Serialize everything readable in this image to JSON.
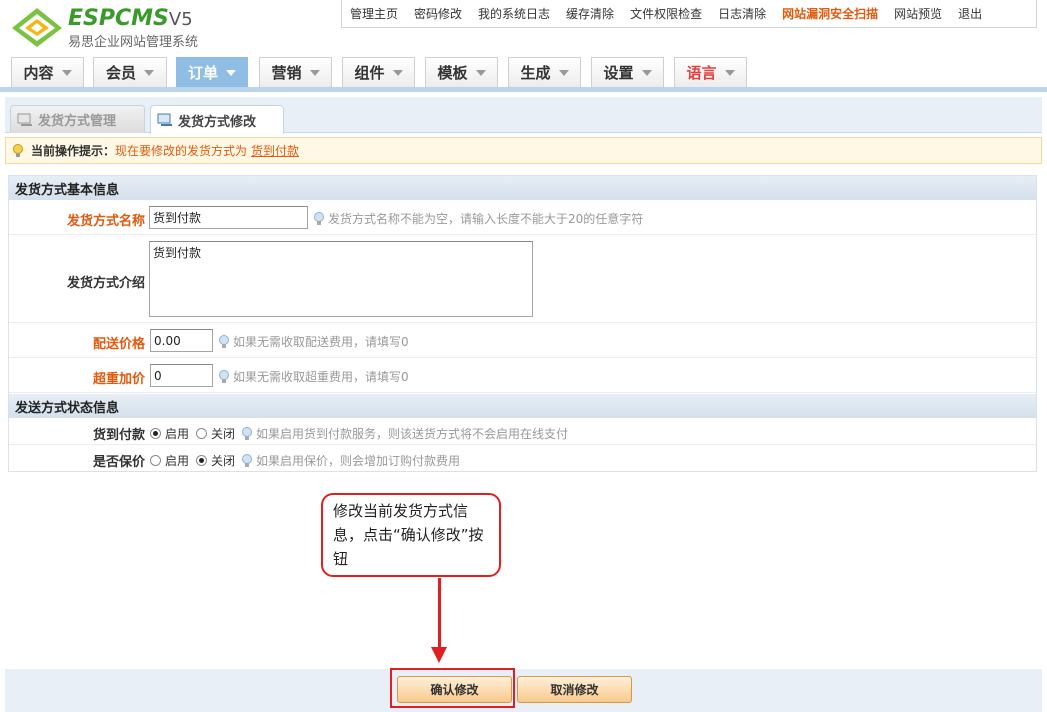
{
  "app": {
    "logo_text": "ESPCMS",
    "logo_version": "V5",
    "logo_subtitle": "易思企业网站管理系统"
  },
  "top_links": [
    {
      "label": "管理主页",
      "highlight": false
    },
    {
      "label": "密码修改",
      "highlight": false
    },
    {
      "label": "我的系统日志",
      "highlight": false
    },
    {
      "label": "缓存清除",
      "highlight": false
    },
    {
      "label": "文件权限检查",
      "highlight": false
    },
    {
      "label": "日志清除",
      "highlight": false
    },
    {
      "label": "网站漏洞安全扫描",
      "highlight": true
    },
    {
      "label": "网站预览",
      "highlight": false
    },
    {
      "label": "退出",
      "highlight": false
    }
  ],
  "main_tabs": [
    {
      "label": "内容",
      "active": false,
      "red": false
    },
    {
      "label": "会员",
      "active": false,
      "red": false
    },
    {
      "label": "订单",
      "active": true,
      "red": false
    },
    {
      "label": "营销",
      "active": false,
      "red": false
    },
    {
      "label": "组件",
      "active": false,
      "red": false
    },
    {
      "label": "模板",
      "active": false,
      "red": false
    },
    {
      "label": "生成",
      "active": false,
      "red": false
    },
    {
      "label": "设置",
      "active": false,
      "red": false
    },
    {
      "label": "语言",
      "active": false,
      "red": true
    }
  ],
  "sub_tabs": [
    {
      "label": "发货方式管理",
      "current": false
    },
    {
      "label": "发货方式修改",
      "current": true
    }
  ],
  "tip": {
    "label": "当前操作提示：",
    "message": "现在要修改的发货方式为",
    "link": "货到付款"
  },
  "sections": {
    "basic": "发货方式基本信息",
    "status": "发送方式状态信息"
  },
  "fields": {
    "name": {
      "label": "发货方式名称",
      "value": "货到付款",
      "hint": "发货方式名称不能为空，请输入长度不能大于20的任意字符"
    },
    "intro": {
      "label": "发货方式介绍",
      "value": "货到付款"
    },
    "price": {
      "label": "配送价格",
      "value": "0.00",
      "hint": "如果无需收取配送费用，请填写0"
    },
    "overweight": {
      "label": "超重加价",
      "value": "0",
      "hint": "如果无需收取超重费用，请填写0"
    },
    "cod": {
      "label": "货到付款",
      "on_label": "启用",
      "off_label": "关闭",
      "selected": "on",
      "hint": "如果启用货到付款服务，则该送货方式将不会启用在线支付"
    },
    "insured": {
      "label": "是否保价",
      "on_label": "启用",
      "off_label": "关闭",
      "selected": "off",
      "hint": "如果启用保价，则会增加订购付款费用"
    }
  },
  "callout": {
    "text": "修改当前发货方式信息，点击“确认修改”按钮"
  },
  "buttons": {
    "confirm": "确认修改",
    "cancel": "取消修改"
  },
  "colors": {
    "accent_orange": "#e05a10",
    "active_tab": "#8fbde4",
    "annotation_red": "#e02020"
  }
}
